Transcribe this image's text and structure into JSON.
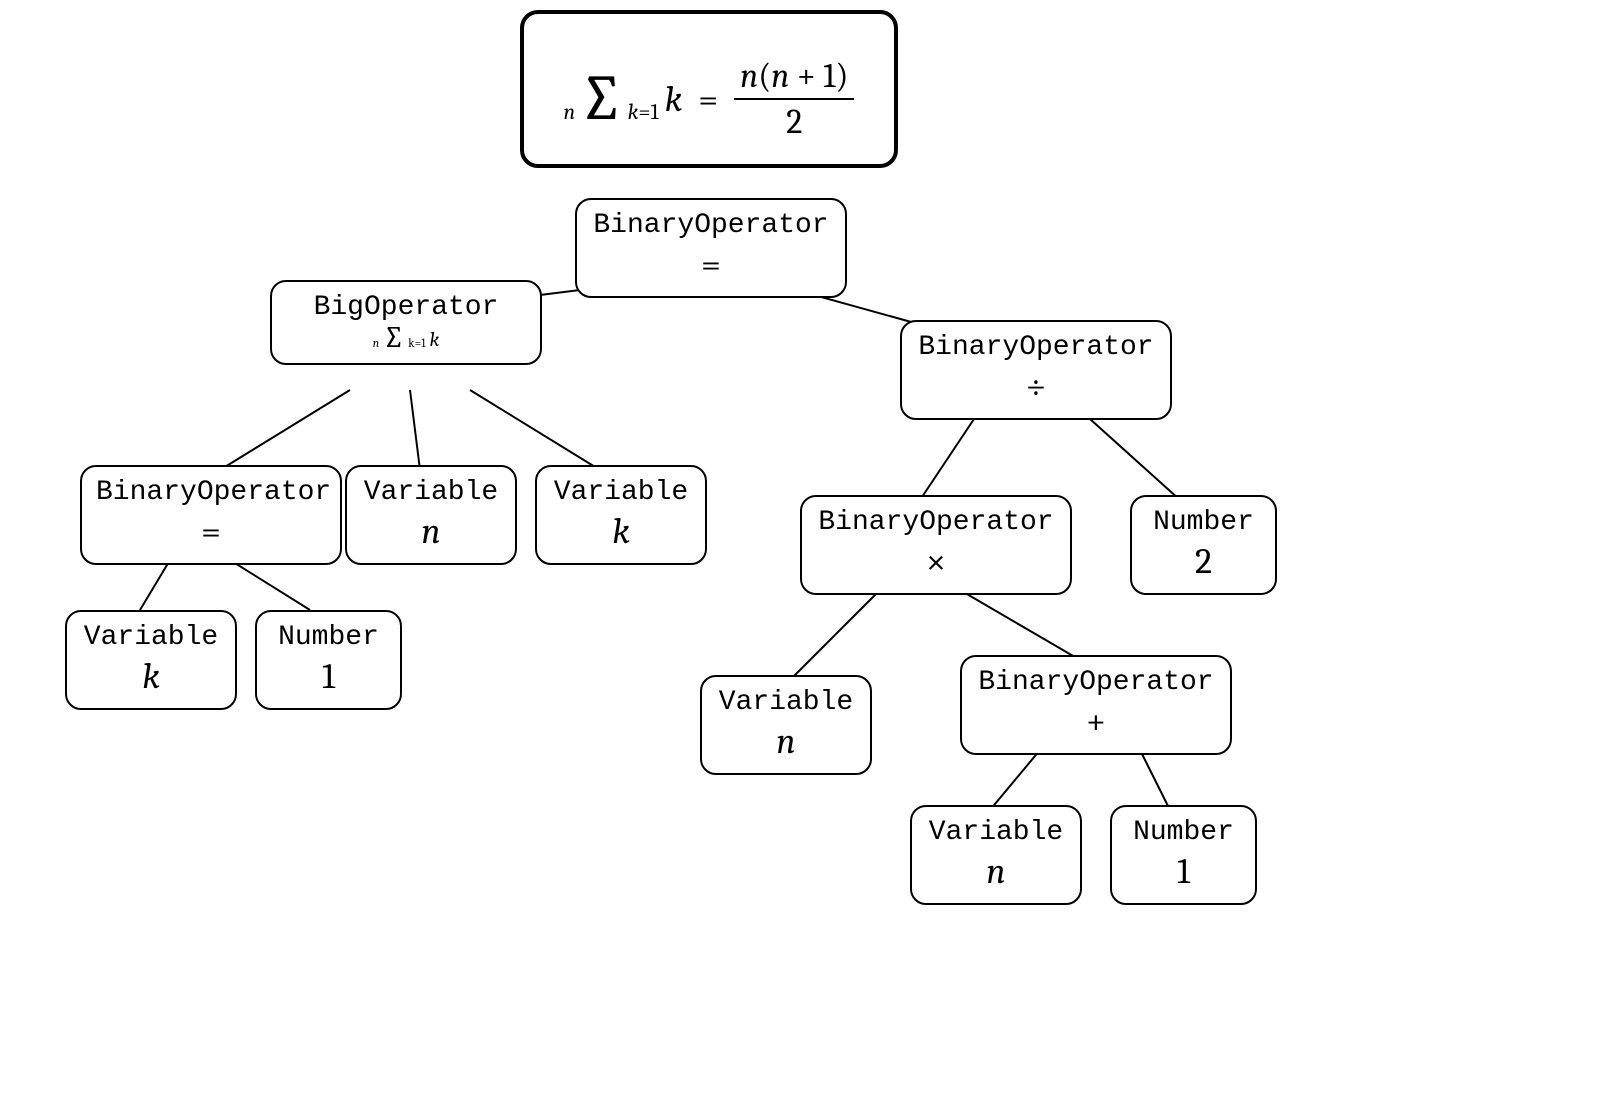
{
  "formula": {
    "sum_upper": "n",
    "sum_lower_lhs": "k",
    "sum_lower_eq": "=",
    "sum_lower_rhs": "1",
    "sum_body": "k",
    "equals": "=",
    "frac_num_left": "n",
    "frac_num_open": "(",
    "frac_num_mid": "n",
    "frac_num_plus": "+ 1",
    "frac_num_close": ")",
    "frac_den": "2"
  },
  "nodes": {
    "root": {
      "type": "BinaryOperator",
      "value": "="
    },
    "bigop": {
      "type": "BigOperator",
      "sum_upper": "n",
      "sum_lower": "k=1",
      "sum_body": "k"
    },
    "div": {
      "type": "BinaryOperator",
      "value": "÷"
    },
    "eq2": {
      "type": "BinaryOperator",
      "value": "="
    },
    "var_n1": {
      "type": "Variable",
      "value": "n"
    },
    "var_k1": {
      "type": "Variable",
      "value": "k"
    },
    "var_k2": {
      "type": "Variable",
      "value": "k"
    },
    "num_1a": {
      "type": "Number",
      "value": "1"
    },
    "mul": {
      "type": "BinaryOperator",
      "value": "×"
    },
    "num_2": {
      "type": "Number",
      "value": "2"
    },
    "var_n2": {
      "type": "Variable",
      "value": "n"
    },
    "plus": {
      "type": "BinaryOperator",
      "value": "+"
    },
    "var_n3": {
      "type": "Variable",
      "value": "n"
    },
    "num_1b": {
      "type": "Number",
      "value": "1"
    }
  }
}
